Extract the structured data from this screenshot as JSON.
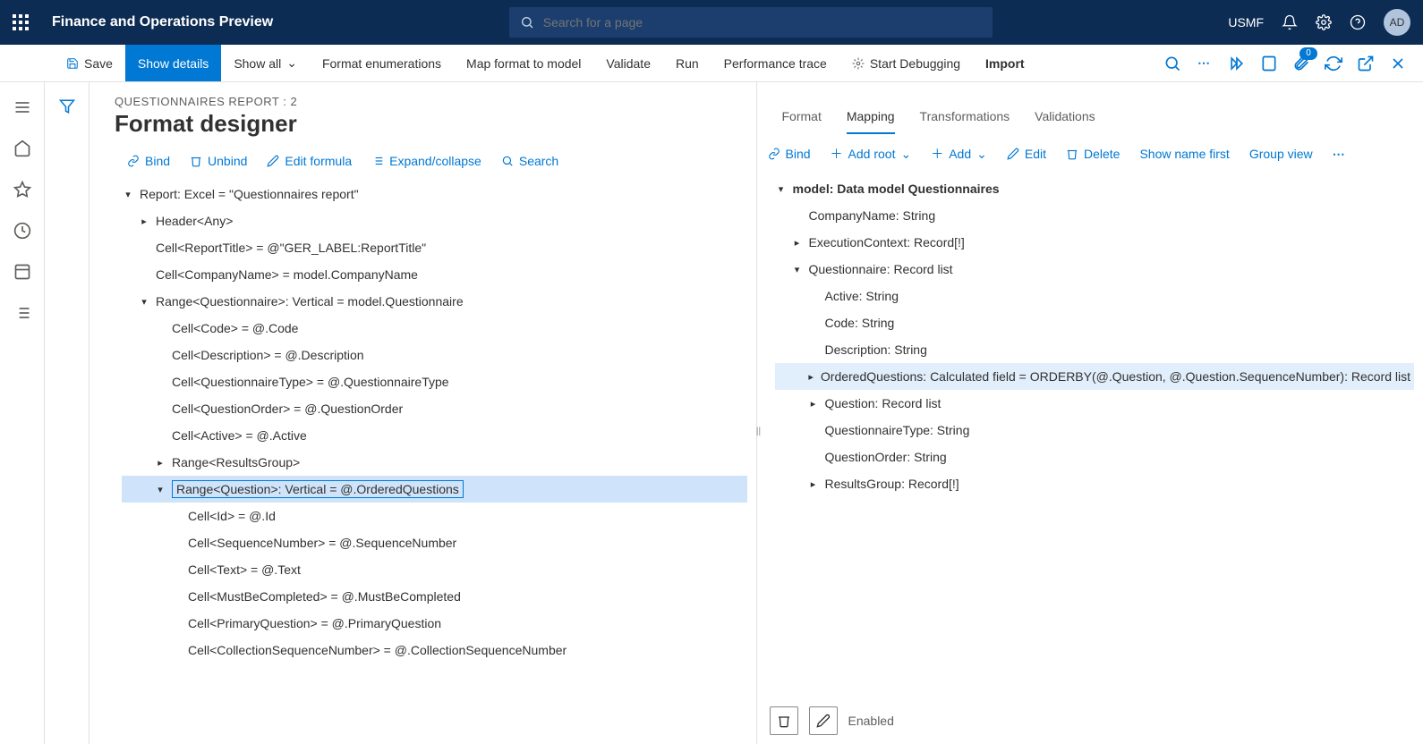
{
  "header": {
    "app_title": "Finance and Operations Preview",
    "search_placeholder": "Search for a page",
    "entity": "USMF",
    "avatar_initials": "AD"
  },
  "cmdbar": {
    "save": "Save",
    "show_details": "Show details",
    "show_all": "Show all",
    "format_enum": "Format enumerations",
    "map_format": "Map format to model",
    "validate": "Validate",
    "run": "Run",
    "perf": "Performance trace",
    "debug": "Start Debugging",
    "import": "Import",
    "attach_count": "0"
  },
  "page": {
    "breadcrumb": "QUESTIONNAIRES REPORT : 2",
    "title": "Format designer"
  },
  "left_toolbar": {
    "bind": "Bind",
    "unbind": "Unbind",
    "edit_formula": "Edit formula",
    "expand": "Expand/collapse",
    "search": "Search"
  },
  "right_tabs": {
    "format": "Format",
    "mapping": "Mapping",
    "transformations": "Transformations",
    "validations": "Validations"
  },
  "right_toolbar": {
    "bind": "Bind",
    "add_root": "Add root",
    "add": "Add",
    "edit": "Edit",
    "delete": "Delete",
    "show_name_first": "Show name first",
    "group_view": "Group view"
  },
  "left_tree": [
    {
      "indent": 0,
      "caret": "down",
      "text": "Report: Excel = \"Questionnaires report\""
    },
    {
      "indent": 1,
      "caret": "right",
      "text": "Header<Any>"
    },
    {
      "indent": 1,
      "caret": "blank",
      "text": "Cell<ReportTitle> = @\"GER_LABEL:ReportTitle\""
    },
    {
      "indent": 1,
      "caret": "blank",
      "text": "Cell<CompanyName> = model.CompanyName"
    },
    {
      "indent": 1,
      "caret": "down",
      "text": "Range<Questionnaire>: Vertical = model.Questionnaire"
    },
    {
      "indent": 2,
      "caret": "blank",
      "text": "Cell<Code> = @.Code"
    },
    {
      "indent": 2,
      "caret": "blank",
      "text": "Cell<Description> = @.Description"
    },
    {
      "indent": 2,
      "caret": "blank",
      "text": "Cell<QuestionnaireType> = @.QuestionnaireType"
    },
    {
      "indent": 2,
      "caret": "blank",
      "text": "Cell<QuestionOrder> = @.QuestionOrder"
    },
    {
      "indent": 2,
      "caret": "blank",
      "text": "Cell<Active> = @.Active"
    },
    {
      "indent": 2,
      "caret": "right",
      "text": "Range<ResultsGroup>"
    },
    {
      "indent": 2,
      "caret": "down",
      "text": "Range<Question>: Vertical = @.OrderedQuestions",
      "selected": true
    },
    {
      "indent": 3,
      "caret": "blank",
      "text": "Cell<Id> = @.Id"
    },
    {
      "indent": 3,
      "caret": "blank",
      "text": "Cell<SequenceNumber> = @.SequenceNumber"
    },
    {
      "indent": 3,
      "caret": "blank",
      "text": "Cell<Text> = @.Text"
    },
    {
      "indent": 3,
      "caret": "blank",
      "text": "Cell<MustBeCompleted> = @.MustBeCompleted"
    },
    {
      "indent": 3,
      "caret": "blank",
      "text": "Cell<PrimaryQuestion> = @.PrimaryQuestion"
    },
    {
      "indent": 3,
      "caret": "blank",
      "text": "Cell<CollectionSequenceNumber> = @.CollectionSequenceNumber"
    }
  ],
  "right_tree": [
    {
      "indent": 0,
      "caret": "down",
      "text": "model: Data model Questionnaires",
      "bold": true
    },
    {
      "indent": 1,
      "caret": "blank",
      "text": "CompanyName: String"
    },
    {
      "indent": 1,
      "caret": "right",
      "text": "ExecutionContext: Record[!]"
    },
    {
      "indent": 1,
      "caret": "down",
      "text": "Questionnaire: Record list"
    },
    {
      "indent": 2,
      "caret": "blank",
      "text": "Active: String"
    },
    {
      "indent": 2,
      "caret": "blank",
      "text": "Code: String"
    },
    {
      "indent": 2,
      "caret": "blank",
      "text": "Description: String"
    },
    {
      "indent": 2,
      "caret": "right",
      "text": "OrderedQuestions: Calculated field = ORDERBY(@.Question, @.Question.SequenceNumber): Record list",
      "hl": true
    },
    {
      "indent": 2,
      "caret": "right",
      "text": "Question: Record list"
    },
    {
      "indent": 2,
      "caret": "blank",
      "text": "QuestionnaireType: String"
    },
    {
      "indent": 2,
      "caret": "blank",
      "text": "QuestionOrder: String"
    },
    {
      "indent": 2,
      "caret": "right",
      "text": "ResultsGroup: Record[!]"
    }
  ],
  "footer": {
    "enabled": "Enabled"
  }
}
